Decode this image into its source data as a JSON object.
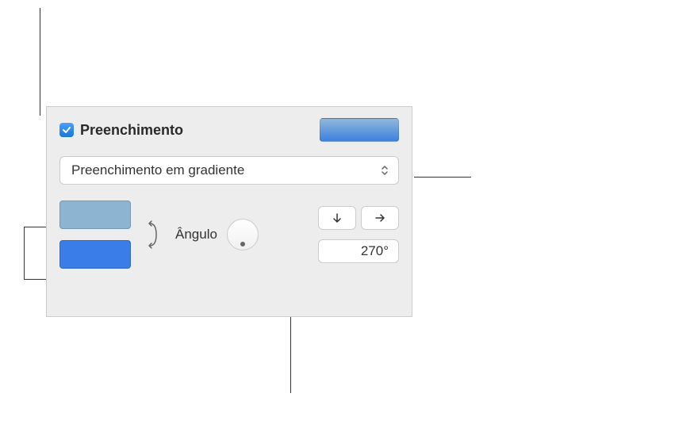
{
  "fill": {
    "checkbox_checked": true,
    "label": "Preenchimento"
  },
  "dropdown": {
    "selected": "Preenchimento em gradiente"
  },
  "colors": {
    "color1": "#8db4d0",
    "color2": "#3b7de8"
  },
  "angle": {
    "label": "Ângulo",
    "value": "270°"
  }
}
